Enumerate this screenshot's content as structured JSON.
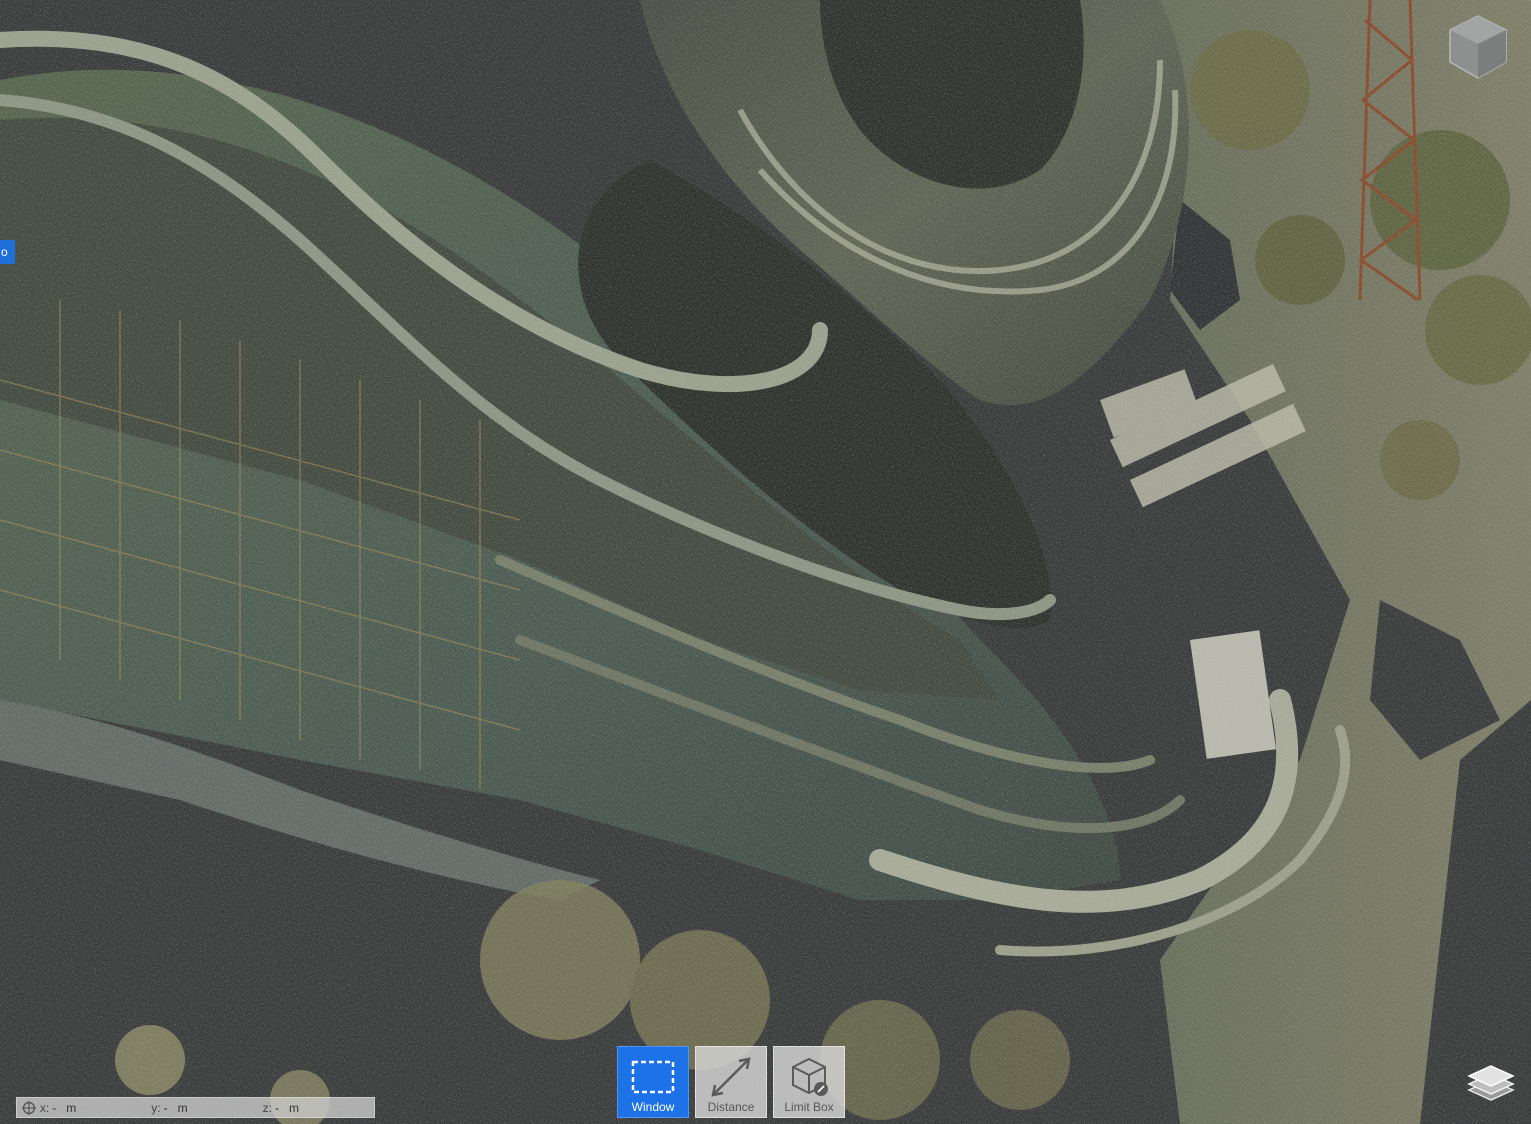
{
  "edge_tab": {
    "label": "o"
  },
  "view_cube": {
    "icon": "view-cube-icon"
  },
  "coordinates": {
    "x_label": "x:",
    "x_value": "-",
    "x_unit": "m",
    "y_label": "y:",
    "y_value": "-",
    "y_unit": "m",
    "z_label": "z:",
    "z_value": "-",
    "z_unit": "m"
  },
  "toolbar": {
    "window_label": "Window",
    "distance_label": "Distance",
    "limit_box_label": "Limit Box"
  },
  "layers": {
    "icon": "layers-icon"
  },
  "colors": {
    "viewport_background": "#3a3b3c",
    "active_tool": "#1c72e6",
    "tool_background": "#d7d7d7"
  }
}
